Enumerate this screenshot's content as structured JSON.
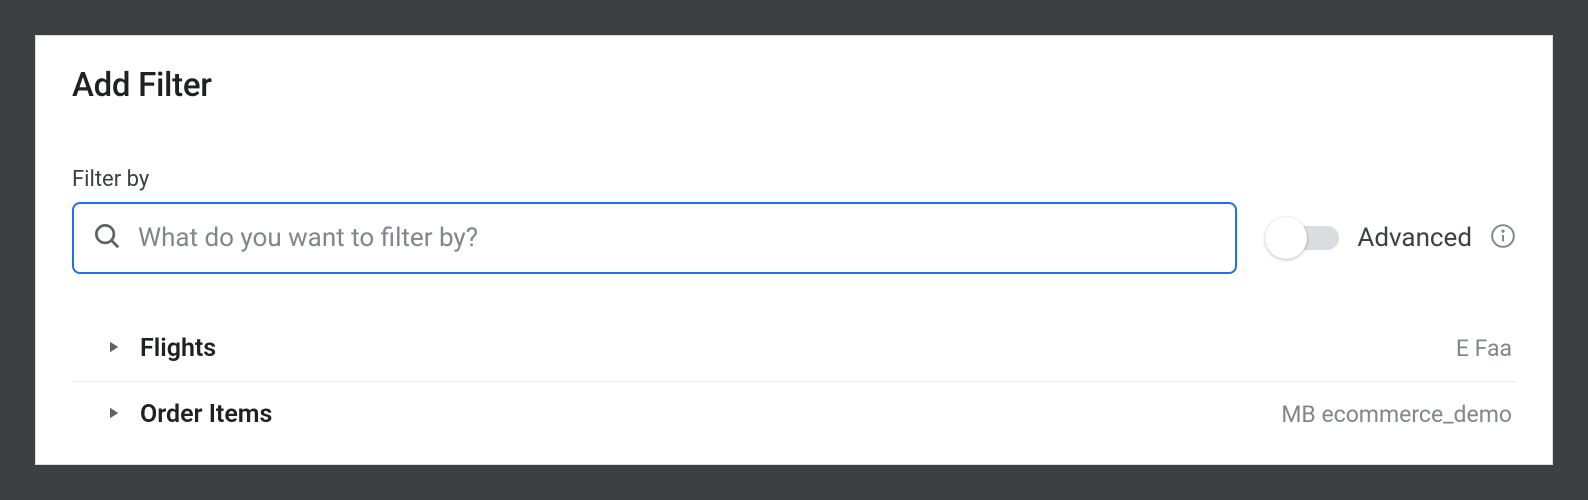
{
  "panel": {
    "title": "Add Filter",
    "filter_label": "Filter by",
    "search_placeholder": "What do you want to filter by?",
    "advanced_label": "Advanced",
    "advanced_on": false
  },
  "items": [
    {
      "label": "Flights",
      "meta": "E Faa"
    },
    {
      "label": "Order Items",
      "meta": "MB ecommerce_demo"
    }
  ]
}
